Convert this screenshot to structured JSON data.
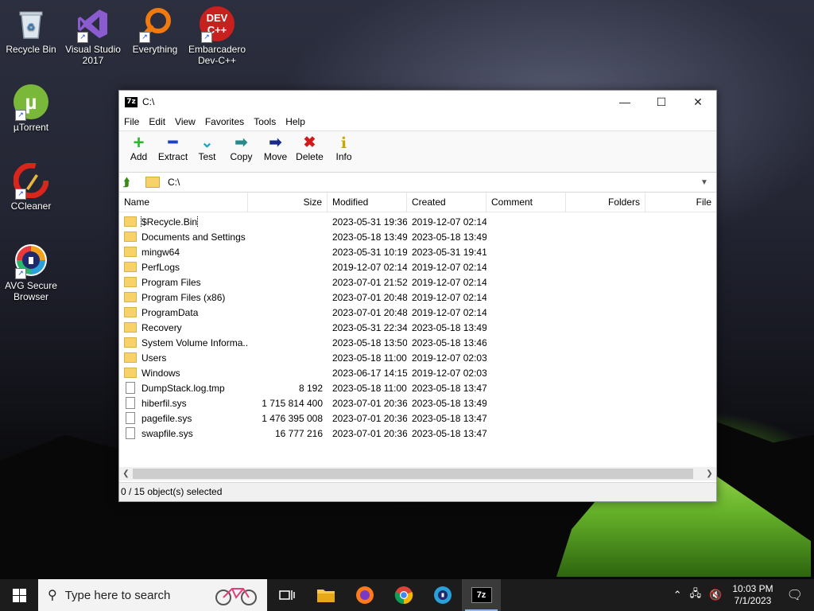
{
  "desktop": {
    "icons": [
      {
        "label": "Recycle Bin"
      },
      {
        "label": "Visual Studio 2017"
      },
      {
        "label": "Everything"
      },
      {
        "label": "Embarcadero Dev-C++",
        "icon_text": "DEV C++"
      },
      {
        "label": "µTorrent"
      },
      {
        "label": "CCleaner"
      },
      {
        "label": "AVG Secure Browser"
      }
    ]
  },
  "window": {
    "app_icon_text": "7z",
    "title": "C:\\",
    "controls": {
      "minimize": "—",
      "maximize": "☐",
      "close": "✕"
    },
    "menu": [
      "File",
      "Edit",
      "View",
      "Favorites",
      "Tools",
      "Help"
    ],
    "toolbar": [
      {
        "label": "Add",
        "glyph": "+",
        "color": "#2db82d"
      },
      {
        "label": "Extract",
        "glyph": "━",
        "color": "#1a3fcf"
      },
      {
        "label": "Test",
        "glyph": "⌄",
        "color": "#1aa8c8"
      },
      {
        "label": "Copy",
        "glyph": "➡",
        "color": "#2a8a8a"
      },
      {
        "label": "Move",
        "glyph": "➡",
        "color": "#1a2a8a"
      },
      {
        "label": "Delete",
        "glyph": "✖",
        "color": "#d21a1a"
      },
      {
        "label": "Info",
        "glyph": "i",
        "color": "#c8a800"
      }
    ],
    "address": "C:\\",
    "columns": [
      "Name",
      "Size",
      "Modified",
      "Created",
      "Comment",
      "Folders",
      "File"
    ],
    "rows": [
      {
        "name": "$Recycle.Bin",
        "size": "",
        "modified": "2023-05-31 19:36",
        "created": "2019-12-07 02:14",
        "type": "folder"
      },
      {
        "name": "Documents and Settings",
        "size": "",
        "modified": "2023-05-18 13:49",
        "created": "2023-05-18 13:49",
        "type": "folder"
      },
      {
        "name": "mingw64",
        "size": "",
        "modified": "2023-05-31 10:19",
        "created": "2023-05-31 19:41",
        "type": "folder"
      },
      {
        "name": "PerfLogs",
        "size": "",
        "modified": "2019-12-07 02:14",
        "created": "2019-12-07 02:14",
        "type": "folder"
      },
      {
        "name": "Program Files",
        "size": "",
        "modified": "2023-07-01 21:52",
        "created": "2019-12-07 02:14",
        "type": "folder"
      },
      {
        "name": "Program Files (x86)",
        "size": "",
        "modified": "2023-07-01 20:48",
        "created": "2019-12-07 02:14",
        "type": "folder"
      },
      {
        "name": "ProgramData",
        "size": "",
        "modified": "2023-07-01 20:48",
        "created": "2019-12-07 02:14",
        "type": "folder"
      },
      {
        "name": "Recovery",
        "size": "",
        "modified": "2023-05-31 22:34",
        "created": "2023-05-18 13:49",
        "type": "folder"
      },
      {
        "name": "System Volume Informa...",
        "size": "",
        "modified": "2023-05-18 13:50",
        "created": "2023-05-18 13:46",
        "type": "folder"
      },
      {
        "name": "Users",
        "size": "",
        "modified": "2023-05-18 11:00",
        "created": "2019-12-07 02:03",
        "type": "folder"
      },
      {
        "name": "Windows",
        "size": "",
        "modified": "2023-06-17 14:15",
        "created": "2019-12-07 02:03",
        "type": "folder"
      },
      {
        "name": "DumpStack.log.tmp",
        "size": "8 192",
        "modified": "2023-05-18 11:00",
        "created": "2023-05-18 13:47",
        "type": "file"
      },
      {
        "name": "hiberfil.sys",
        "size": "1 715 814 400",
        "modified": "2023-07-01 20:36",
        "created": "2023-05-18 13:49",
        "type": "file"
      },
      {
        "name": "pagefile.sys",
        "size": "1 476 395 008",
        "modified": "2023-07-01 20:36",
        "created": "2023-05-18 13:47",
        "type": "file"
      },
      {
        "name": "swapfile.sys",
        "size": "16 777 216",
        "modified": "2023-07-01 20:36",
        "created": "2023-05-18 13:47",
        "type": "file"
      }
    ],
    "status": "0 / 15 object(s) selected"
  },
  "taskbar": {
    "search_placeholder": "Type here to search",
    "time": "10:03 PM",
    "date": "7/1/2023"
  }
}
